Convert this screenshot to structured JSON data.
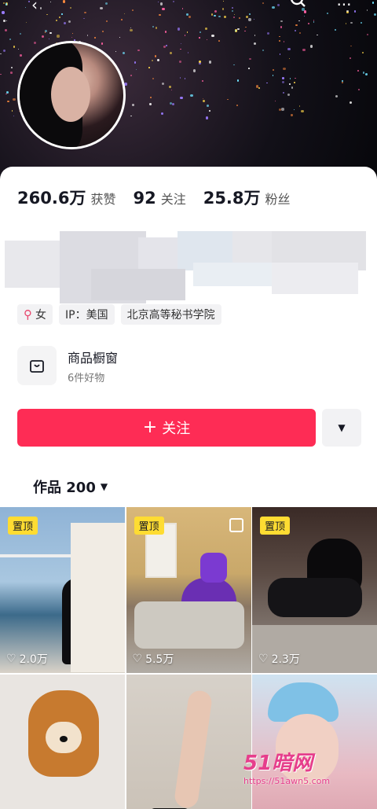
{
  "stats": {
    "likes_value": "260.6万",
    "likes_label": "获赞",
    "following_value": "92",
    "following_label": "关注",
    "followers_value": "25.8万",
    "followers_label": "粉丝"
  },
  "tags": {
    "gender": "女",
    "gender_icon": "venus-icon",
    "ip": "IP：美国",
    "school": "北京高等秘书学院"
  },
  "shop": {
    "title": "商品橱窗",
    "subtitle": "6件好物",
    "icon": "shopping-bag-icon"
  },
  "follow_button": {
    "label": "关注",
    "icon": "plus-icon"
  },
  "works_tab": {
    "label": "作品 200"
  },
  "pinned_label": "置顶",
  "videos": [
    {
      "pinned": true,
      "likes": "2.0万"
    },
    {
      "pinned": true,
      "likes": "5.5万"
    },
    {
      "pinned": true,
      "likes": "2.3万"
    },
    {
      "pinned": false,
      "likes": ""
    },
    {
      "pinned": false,
      "likes": ""
    },
    {
      "pinned": false,
      "likes": ""
    }
  ],
  "watermark": {
    "logo": "51暗网",
    "url": "https://51awn5.com"
  },
  "colors": {
    "accent": "#fe2c55",
    "pin_badge": "#fedc32"
  }
}
